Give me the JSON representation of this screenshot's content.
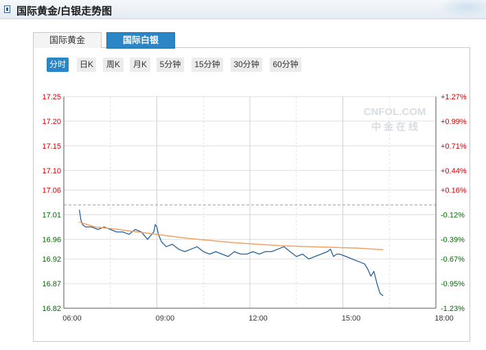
{
  "header": {
    "title": "国际黄金/白银走势图"
  },
  "tabs": [
    {
      "label": "国际黄金",
      "active": false
    },
    {
      "label": "国际白银",
      "active": true
    }
  ],
  "periods": [
    {
      "label": "分时",
      "active": true
    },
    {
      "label": "日K",
      "active": false
    },
    {
      "label": "周K",
      "active": false
    },
    {
      "label": "月K",
      "active": false
    },
    {
      "label": "5分钟",
      "active": false
    },
    {
      "label": "15分钟",
      "active": false
    },
    {
      "label": "30分钟",
      "active": false
    },
    {
      "label": "60分钟",
      "active": false
    }
  ],
  "watermark": {
    "line1": "CNFOL.COM",
    "line2": "中 金 在 线"
  },
  "colors": {
    "price_line": "#1d5f99",
    "avg_line": "#f0a060",
    "up_text": "#cc0000",
    "down_text": "#006600",
    "accent": "#2b86c8",
    "grid": "#dddddd"
  },
  "chart_data": {
    "type": "line",
    "x_tick_labels": [
      "06:00",
      "09:00",
      "12:00",
      "15:00",
      "18:00"
    ],
    "x_tick_hours": [
      6,
      9,
      12,
      15,
      18
    ],
    "xlim": [
      6,
      18
    ],
    "ylim": [
      16.82,
      17.25
    ],
    "y_tick_values": [
      17.25,
      17.2,
      17.15,
      17.1,
      17.06,
      17.01,
      16.96,
      16.92,
      16.87,
      16.82
    ],
    "y_tick_labels": [
      "17.25",
      "17.20",
      "17.15",
      "17.10",
      "17.06",
      "17.01",
      "16.96",
      "16.92",
      "16.87",
      "16.82"
    ],
    "right_tick_labels": [
      "+1.27%",
      "+0.99%",
      "+0.71%",
      "+0.44%",
      "+0.16%",
      "-0.12%",
      "-0.39%",
      "-0.67%",
      "-0.95%",
      "-1.23%"
    ],
    "right_tick_colors": [
      "up",
      "up",
      "up",
      "up",
      "up",
      "down",
      "down",
      "down",
      "down",
      "down"
    ],
    "reference_price": 17.03,
    "grid": true,
    "series": [
      {
        "role": "price",
        "x": [
          6.5,
          6.55,
          6.6,
          6.7,
          6.9,
          7.1,
          7.3,
          7.5,
          7.7,
          7.9,
          8.1,
          8.3,
          8.5,
          8.7,
          8.9,
          8.95,
          9.0,
          9.05,
          9.15,
          9.3,
          9.5,
          9.7,
          9.9,
          10.1,
          10.3,
          10.5,
          10.7,
          10.9,
          11.1,
          11.3,
          11.5,
          11.7,
          11.9,
          12.1,
          12.3,
          12.5,
          12.7,
          12.9,
          13.1,
          13.3,
          13.5,
          13.7,
          13.9,
          14.1,
          14.3,
          14.5,
          14.6,
          14.7,
          14.8,
          14.9,
          15.1,
          15.3,
          15.5,
          15.7,
          15.8,
          15.9,
          16.0,
          16.1,
          16.2,
          16.3
        ],
        "y": [
          17.02,
          17.0,
          16.99,
          16.985,
          16.985,
          16.98,
          16.985,
          16.98,
          16.975,
          16.975,
          16.97,
          16.98,
          16.975,
          16.96,
          16.975,
          16.99,
          16.985,
          16.97,
          16.955,
          16.945,
          16.95,
          16.94,
          16.935,
          16.94,
          16.945,
          16.935,
          16.93,
          16.935,
          16.93,
          16.925,
          16.935,
          16.93,
          16.93,
          16.935,
          16.93,
          16.935,
          16.935,
          16.94,
          16.945,
          16.935,
          16.925,
          16.93,
          16.92,
          16.925,
          16.93,
          16.935,
          16.94,
          16.925,
          16.93,
          16.93,
          16.925,
          16.92,
          16.915,
          16.91,
          16.9,
          16.885,
          16.895,
          16.87,
          16.85,
          16.845
        ]
      },
      {
        "role": "average",
        "x": [
          6.5,
          7.0,
          7.5,
          8.0,
          8.5,
          9.0,
          9.5,
          10.0,
          10.5,
          11.0,
          11.5,
          12.0,
          12.5,
          13.0,
          13.5,
          14.0,
          14.5,
          15.0,
          15.5,
          16.0,
          16.3
        ],
        "y": [
          16.995,
          16.985,
          16.982,
          16.978,
          16.974,
          16.97,
          16.966,
          16.962,
          16.959,
          16.956,
          16.953,
          16.951,
          16.949,
          16.947,
          16.946,
          16.945,
          16.944,
          16.943,
          16.942,
          16.94,
          16.939
        ]
      }
    ]
  }
}
